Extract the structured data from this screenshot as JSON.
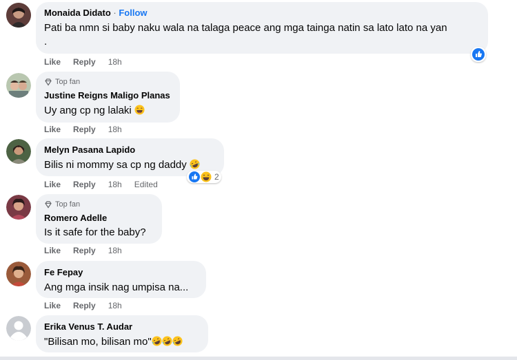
{
  "comments": [
    {
      "author": "Monaida Didato",
      "follow_sep": " · ",
      "follow": "Follow",
      "text": "Pati ba nmn si baby naku wala na talaga peace ang mga tainga natin sa lato lato na yan",
      "text2": ".",
      "like": "Like",
      "reply": "Reply",
      "time": "18h",
      "avatar_color": "#6b4b49"
    },
    {
      "badge": "Top fan",
      "author": "Justine Reigns Maligo Planas",
      "text": "Uy ang cp ng lalaki",
      "like": "Like",
      "reply": "Reply",
      "time": "18h",
      "avatar_color": "#8fa38a"
    },
    {
      "author": "Melyn Pasana Lapido",
      "text": "Bilis ni mommy sa cp ng daddy",
      "like": "Like",
      "reply": "Reply",
      "time": "18h",
      "edited": "Edited",
      "reaction_count": "2",
      "avatar_color": "#5a6f52"
    },
    {
      "badge": "Top fan",
      "author": "Romero Adelle",
      "text": "Is it safe for the baby?",
      "like": "Like",
      "reply": "Reply",
      "time": "18h",
      "avatar_color": "#7a3a45"
    },
    {
      "author": "Fe Fepay",
      "text": "Ang mga insik nag umpisa na...",
      "like": "Like",
      "reply": "Reply",
      "time": "18h",
      "avatar_color": "#9a5a3a"
    },
    {
      "author": "Erika Venus T. Audar",
      "text": "\"Bilisan mo, bilisan mo\"",
      "avatar_color": "#c9ccd1"
    }
  ],
  "colors": {
    "bubble": "#f0f2f5",
    "link": "#1877f2",
    "meta": "#65676b"
  },
  "icons": [
    "like-reaction-icon",
    "laugh-emoji-icon",
    "rofl-emoji-icon",
    "top-fan-diamond-icon",
    "default-avatar-icon"
  ]
}
